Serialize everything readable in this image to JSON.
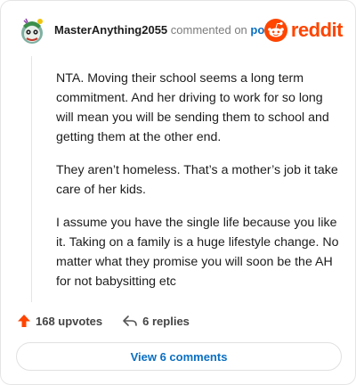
{
  "header": {
    "username": "MasterAnything2055",
    "commented_text": "commented on",
    "post_link": "post",
    "logo_text": "reddit"
  },
  "comment": {
    "paragraphs": [
      "NTA. Moving their school seems a long term commitment. And her driving to work for so long will mean you will be sending them to school and getting them at the other end.",
      "They aren’t homeless. That’s a mother’s job it take care of her kids.",
      "I assume you have the single life because you like it. Taking on a family is a huge lifestyle change. No matter what they promise you will soon be the AH for not babysitting etc"
    ]
  },
  "actions": {
    "upvotes": "168 upvotes",
    "replies": "6 replies"
  },
  "view_comments_label": "View 6 comments",
  "colors": {
    "brand": "#ff4500",
    "link": "#0a6fc2"
  }
}
